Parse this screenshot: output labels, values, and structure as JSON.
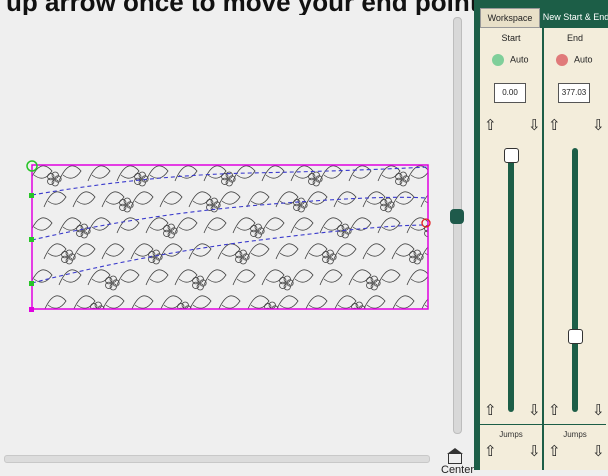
{
  "banner": {
    "text": "up arrow once to move your end point."
  },
  "canvas": {
    "colors": {
      "border": "#e000e0",
      "path": "#3a3acc",
      "quilt": "#444444",
      "green": "#27c427",
      "red": "#e02020"
    }
  },
  "center_button": {
    "label": "Center"
  },
  "panel": {
    "tabs": [
      {
        "label": "Workspace",
        "active": false
      },
      {
        "label": "New Start & End",
        "active": true
      }
    ],
    "start": {
      "title": "Start",
      "auto_label": "Auto",
      "value": "0.00",
      "up_arrow": "⇧",
      "down_arrow": "⇩",
      "slider_level": 0.0,
      "jumps_label": "Jumps"
    },
    "end": {
      "title": "End",
      "auto_label": "Auto",
      "value": "377.03",
      "up_arrow": "⇧",
      "down_arrow": "⇩",
      "slider_level": 0.72,
      "jumps_label": "Jumps"
    },
    "colors": {
      "accent": "#1c5e47",
      "panel_bg": "#f3eddb"
    }
  }
}
